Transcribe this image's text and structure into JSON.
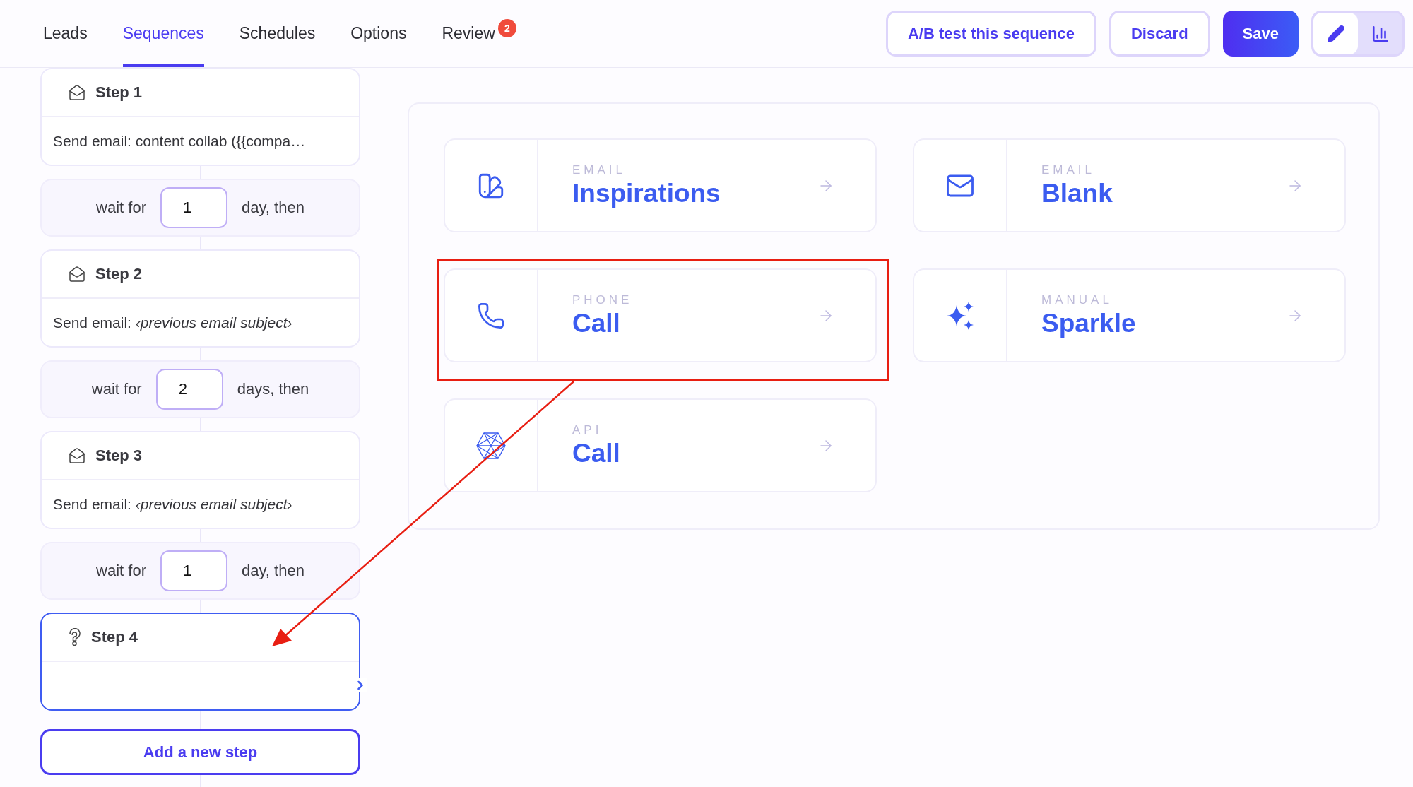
{
  "tabs": [
    {
      "label": "Leads",
      "selected": false
    },
    {
      "label": "Sequences",
      "selected": true
    },
    {
      "label": "Schedules",
      "selected": false
    },
    {
      "label": "Options",
      "selected": false
    },
    {
      "label": "Review",
      "selected": false,
      "badge": "2"
    }
  ],
  "actions": [
    {
      "label": "A/B test this sequence",
      "kind": "outline"
    },
    {
      "label": "Discard",
      "kind": "outline"
    },
    {
      "label": "Save",
      "kind": "primary"
    }
  ],
  "view_toggle": [
    {
      "kind": "edit",
      "selected": true
    },
    {
      "kind": "stats",
      "selected": false
    }
  ],
  "steps": [
    {
      "kind": "email",
      "title": "Step 1",
      "text": "Send email: content collab ({{compa…",
      "selected": false
    },
    {
      "kind": "wait",
      "prefix": "wait for",
      "value": "1",
      "suffix": "day, then"
    },
    {
      "kind": "email",
      "title": "Step 2",
      "text": "Send email: *‹previous email subject›*",
      "selected": false
    },
    {
      "kind": "wait",
      "prefix": "wait for",
      "value": "2",
      "suffix": "days, then"
    },
    {
      "kind": "email",
      "title": "Step 3",
      "text": "Send email: *‹previous email subject›*",
      "selected": false
    },
    {
      "kind": "wait",
      "prefix": "wait for",
      "value": "1",
      "suffix": "day, then"
    },
    {
      "kind": "unknown",
      "title": "Step 4",
      "selected": true
    }
  ],
  "add_step": "Add a new step",
  "options": [
    {
      "kind": "inspirations",
      "category": "EMAIL",
      "title": "Inspirations",
      "highlighted": false
    },
    {
      "kind": "blank",
      "category": "EMAIL",
      "title": "Blank",
      "highlighted": false
    },
    {
      "kind": "phone",
      "category": "PHONE",
      "title": "Call",
      "highlighted": true
    },
    {
      "kind": "sparkle",
      "category": "MANUAL",
      "title": "Sparkle",
      "highlighted": false
    },
    {
      "kind": "api",
      "category": "API",
      "title": "Call",
      "highlighted": false
    }
  ]
}
